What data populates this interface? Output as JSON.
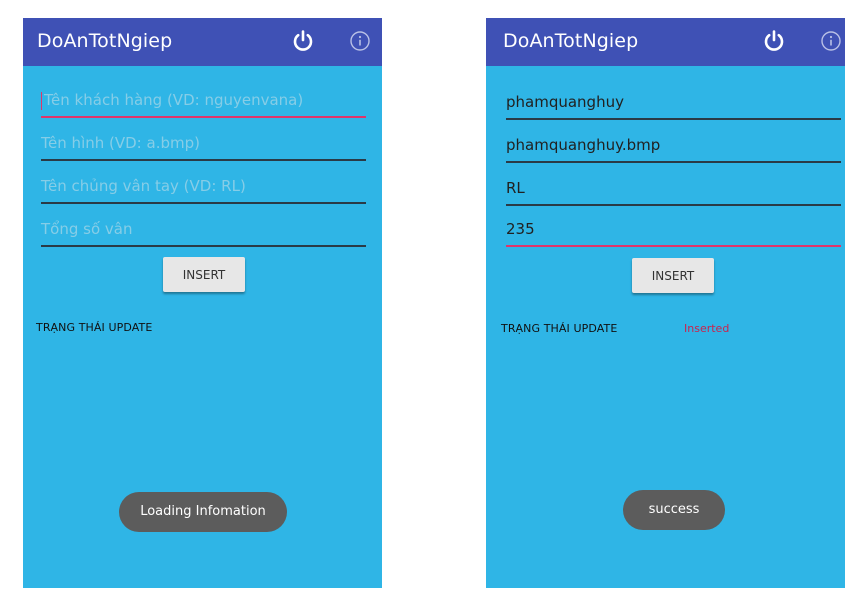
{
  "screens": [
    {
      "app_title": "DoAnTotNgiep",
      "fields": [
        {
          "value": "",
          "placeholder": "Tên khách hàng (VD: nguyenvana)"
        },
        {
          "value": "",
          "placeholder": "Tên hình (VD: a.bmp)"
        },
        {
          "value": "",
          "placeholder": "Tên chủng vân tay (VD: RL)"
        },
        {
          "value": "",
          "placeholder": "Tổng số vân"
        }
      ],
      "insert_label": "INSERT",
      "status_label": "TRẠNG THÁI UPDATE",
      "status_value": "",
      "toast": "Loading Infomation"
    },
    {
      "app_title": "DoAnTotNgiep",
      "fields": [
        {
          "value": "phamquanghuy",
          "placeholder": ""
        },
        {
          "value": "phamquanghuy.bmp",
          "placeholder": ""
        },
        {
          "value": "RL",
          "placeholder": ""
        },
        {
          "value": "235",
          "placeholder": ""
        }
      ],
      "insert_label": "INSERT",
      "status_label": "TRẠNG THÁI UPDATE",
      "status_value": "Inserted",
      "toast": "success"
    }
  ],
  "icons": {
    "power": "power-icon",
    "info": "info-icon"
  },
  "colors": {
    "app_bar": "#3f51b5",
    "background": "#2fb5e6",
    "accent": "#e0356a",
    "status_value": "#c8244e",
    "toast": "#5c5c5c"
  }
}
